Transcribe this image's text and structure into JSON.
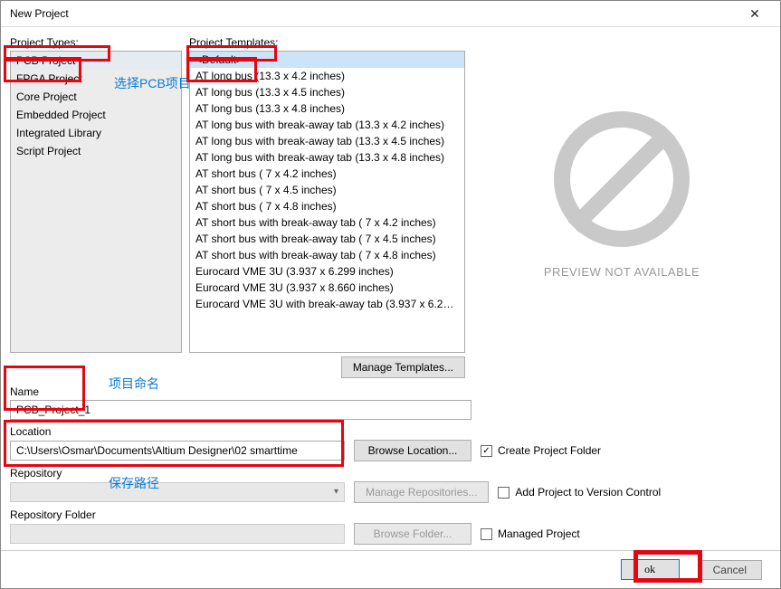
{
  "window": {
    "title": "New Project"
  },
  "labels": {
    "project_types": "Project Types:",
    "project_templates": "Project Templates:",
    "name": "Name",
    "location": "Location",
    "repository": "Repository",
    "repository_folder": "Repository Folder"
  },
  "project_types": {
    "items": [
      "PCB Project",
      "FPGA Project",
      "Core Project",
      "Embedded Project",
      "Integrated Library",
      "Script Project"
    ],
    "selected_index": 0
  },
  "project_templates": {
    "items": [
      "<Default>",
      "AT long bus (13.3 x 4.2 inches)",
      "AT long bus (13.3 x 4.5 inches)",
      "AT long bus (13.3 x 4.8 inches)",
      "AT long bus with break-away tab (13.3 x 4.2 inches)",
      "AT long bus with break-away tab (13.3 x 4.5 inches)",
      "AT long bus with break-away tab (13.3 x 4.8 inches)",
      "AT short bus ( 7 x 4.2 inches)",
      "AT short bus ( 7 x 4.5 inches)",
      "AT short bus ( 7 x 4.8 inches)",
      "AT short bus with break-away tab ( 7 x 4.2 inches)",
      "AT short bus with break-away tab ( 7 x 4.5 inches)",
      "AT short bus with break-away tab ( 7 x 4.8 inches)",
      "Eurocard VME 3U (3.937 x 6.299 inches)",
      "Eurocard VME 3U (3.937 x 8.660 inches)",
      "Eurocard VME 3U with break-away tab (3.937 x 6.299 …"
    ],
    "selected_index": 0
  },
  "preview": {
    "text": "PREVIEW NOT AVAILABLE"
  },
  "buttons": {
    "manage_templates": "Manage Templates...",
    "browse_location": "Browse Location...",
    "manage_repositories": "Manage Repositories...",
    "browse_folder": "Browse Folder...",
    "ok": "ok",
    "cancel": "Cancel"
  },
  "fields": {
    "name": "PCB_Project_1",
    "location": "C:\\Users\\Osmar\\Documents\\Altium Designer\\02 smarttime",
    "repository": "",
    "repository_folder": ""
  },
  "checkboxes": {
    "create_folder": {
      "label": "Create Project Folder",
      "checked": true
    },
    "version_control": {
      "label": "Add Project to Version Control",
      "checked": false
    },
    "managed_project": {
      "label": "Managed Project",
      "checked": false
    }
  },
  "annotations": {
    "select_pcb": "选择PCB项目",
    "project_name": "项目命名",
    "save_path": "保存路径"
  }
}
